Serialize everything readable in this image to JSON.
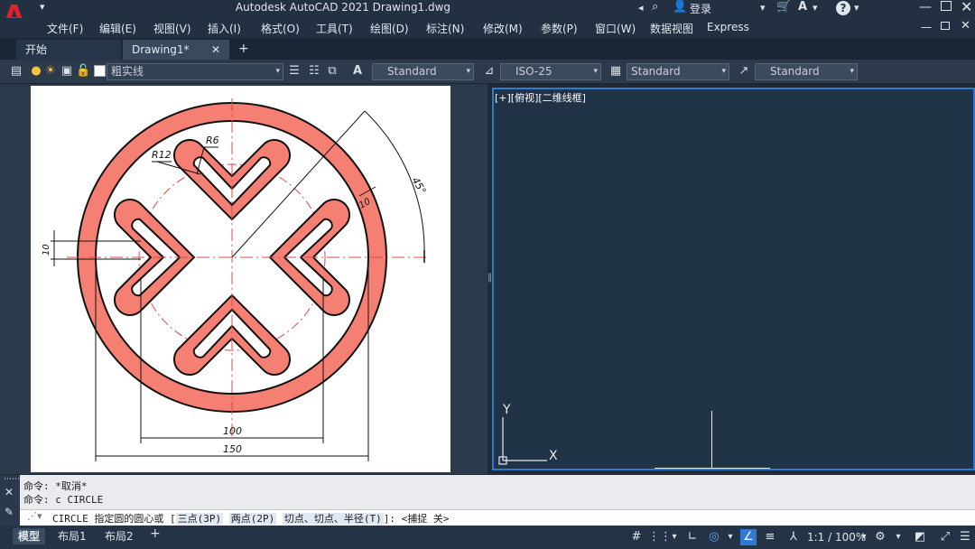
{
  "window": {
    "title": "Autodesk AutoCAD 2021    Drawing1.dwg",
    "login": "登录",
    "express": "Express"
  },
  "menu": [
    "文件(F)",
    "编辑(E)",
    "视图(V)",
    "插入(I)",
    "格式(O)",
    "工具(T)",
    "绘图(D)",
    "标注(N)",
    "修改(M)",
    "参数(P)",
    "窗口(W)",
    "数据视图",
    "Express"
  ],
  "tabs": [
    {
      "label": "开始"
    },
    {
      "label": "Drawing1*"
    }
  ],
  "toolbar": {
    "layer_combo": "粗实线",
    "text_style": "Standard",
    "dim_style": "ISO-25",
    "table_style": "Standard",
    "multileader_style": "Standard"
  },
  "drawing": {
    "labels": {
      "r12": "R12",
      "r6": "R6",
      "angle": "45°",
      "ten_right": "10",
      "ten_left": "10",
      "dim100": "100",
      "dim150": "150"
    },
    "colors": {
      "fill": "#f47f72",
      "outline": "#111111",
      "centerline": "#d94b4b"
    }
  },
  "viewport": {
    "label": "[+][俯视][二维线框]",
    "ucs_y": "Y",
    "ucs_x": "X"
  },
  "command": {
    "history": [
      "命令: *取消*",
      "命令: c CIRCLE"
    ],
    "prompt_prefix": "CIRCLE 指定圆的圆心或 [",
    "opt1": "三点(3P)",
    "opt2": "两点(2P)",
    "opt3": "切点、切点、半径(T)",
    "prompt_suffix": "]:  <捕捉 关>"
  },
  "status": {
    "tabs": [
      "模型",
      "布局1",
      "布局2"
    ],
    "scale": "1:1 / 100%"
  }
}
